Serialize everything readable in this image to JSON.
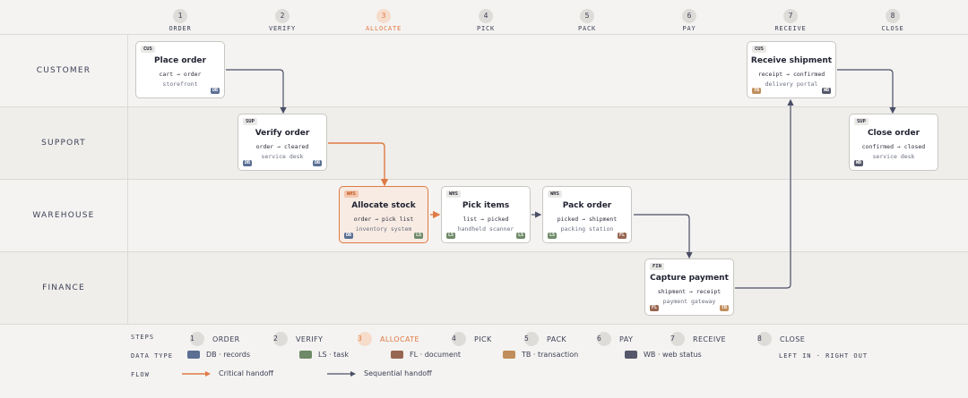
{
  "colors": {
    "accent": "#e07a45",
    "sequential": "#4a4e66",
    "DB": "#5b6f94",
    "LS": "#6f8a68",
    "FL": "#976650",
    "TB": "#c08e5c",
    "WB": "#55586a"
  },
  "steps": [
    {
      "num": "1",
      "label": "ORDER"
    },
    {
      "num": "2",
      "label": "VERIFY"
    },
    {
      "num": "3",
      "label": "ALLOCATE"
    },
    {
      "num": "4",
      "label": "PICK"
    },
    {
      "num": "5",
      "label": "PACK"
    },
    {
      "num": "6",
      "label": "PAY"
    },
    {
      "num": "7",
      "label": "RECEIVE"
    },
    {
      "num": "8",
      "label": "CLOSE"
    }
  ],
  "active_step": "3",
  "lanes": [
    "CUSTOMER",
    "SUPPORT",
    "WAREHOUSE",
    "FINANCE"
  ],
  "nodes": [
    {
      "tag": "CUS",
      "title": "Place order",
      "io": "cart → order",
      "sys": "storefront",
      "chips": [
        "",
        "DB"
      ]
    },
    {
      "tag": "SUP",
      "title": "Verify order",
      "io": "order → cleared",
      "sys": "service desk",
      "chips": [
        "DB",
        "DB"
      ]
    },
    {
      "tag": "WHS",
      "title": "Allocate stock",
      "io": "order → pick list",
      "sys": "inventory system",
      "chips": [
        "DB",
        "LS"
      ]
    },
    {
      "tag": "WHS",
      "title": "Pick items",
      "io": "list → picked",
      "sys": "handheld scanner",
      "chips": [
        "LS",
        "LS"
      ]
    },
    {
      "tag": "WHS",
      "title": "Pack order",
      "io": "picked → shipment",
      "sys": "packing station",
      "chips": [
        "LS",
        "FL"
      ]
    },
    {
      "tag": "FIN",
      "title": "Capture payment",
      "io": "shipment → receipt",
      "sys": "payment gateway",
      "chips": [
        "FL",
        "TB"
      ]
    },
    {
      "tag": "CUS",
      "title": "Receive shipment",
      "io": "receipt → confirmed",
      "sys": "delivery portal",
      "chips": [
        "TB",
        "WB"
      ]
    },
    {
      "tag": "SUP",
      "title": "Close order",
      "io": "confirmed → closed",
      "sys": "service desk",
      "chips": [
        "WB",
        ""
      ]
    }
  ],
  "legend": {
    "steps_label": "STEPS",
    "steps": [
      "ORDER",
      "VERIFY",
      "ALLOCATE",
      "PICK",
      "PACK",
      "PAY",
      "RECEIVE",
      "CLOSE"
    ],
    "data_type_label": "DATA TYPE",
    "types": [
      {
        "code": "DB",
        "text": "DB · records"
      },
      {
        "code": "LS",
        "text": "LS · task"
      },
      {
        "code": "FL",
        "text": "FL · document"
      },
      {
        "code": "TB",
        "text": "TB · transaction"
      },
      {
        "code": "WB",
        "text": "WB · web status"
      }
    ],
    "flow_label": "FLOW",
    "critical": "Critical handoff",
    "sequential": "Sequential handoff",
    "note": "LEFT IN · RIGHT OUT"
  }
}
